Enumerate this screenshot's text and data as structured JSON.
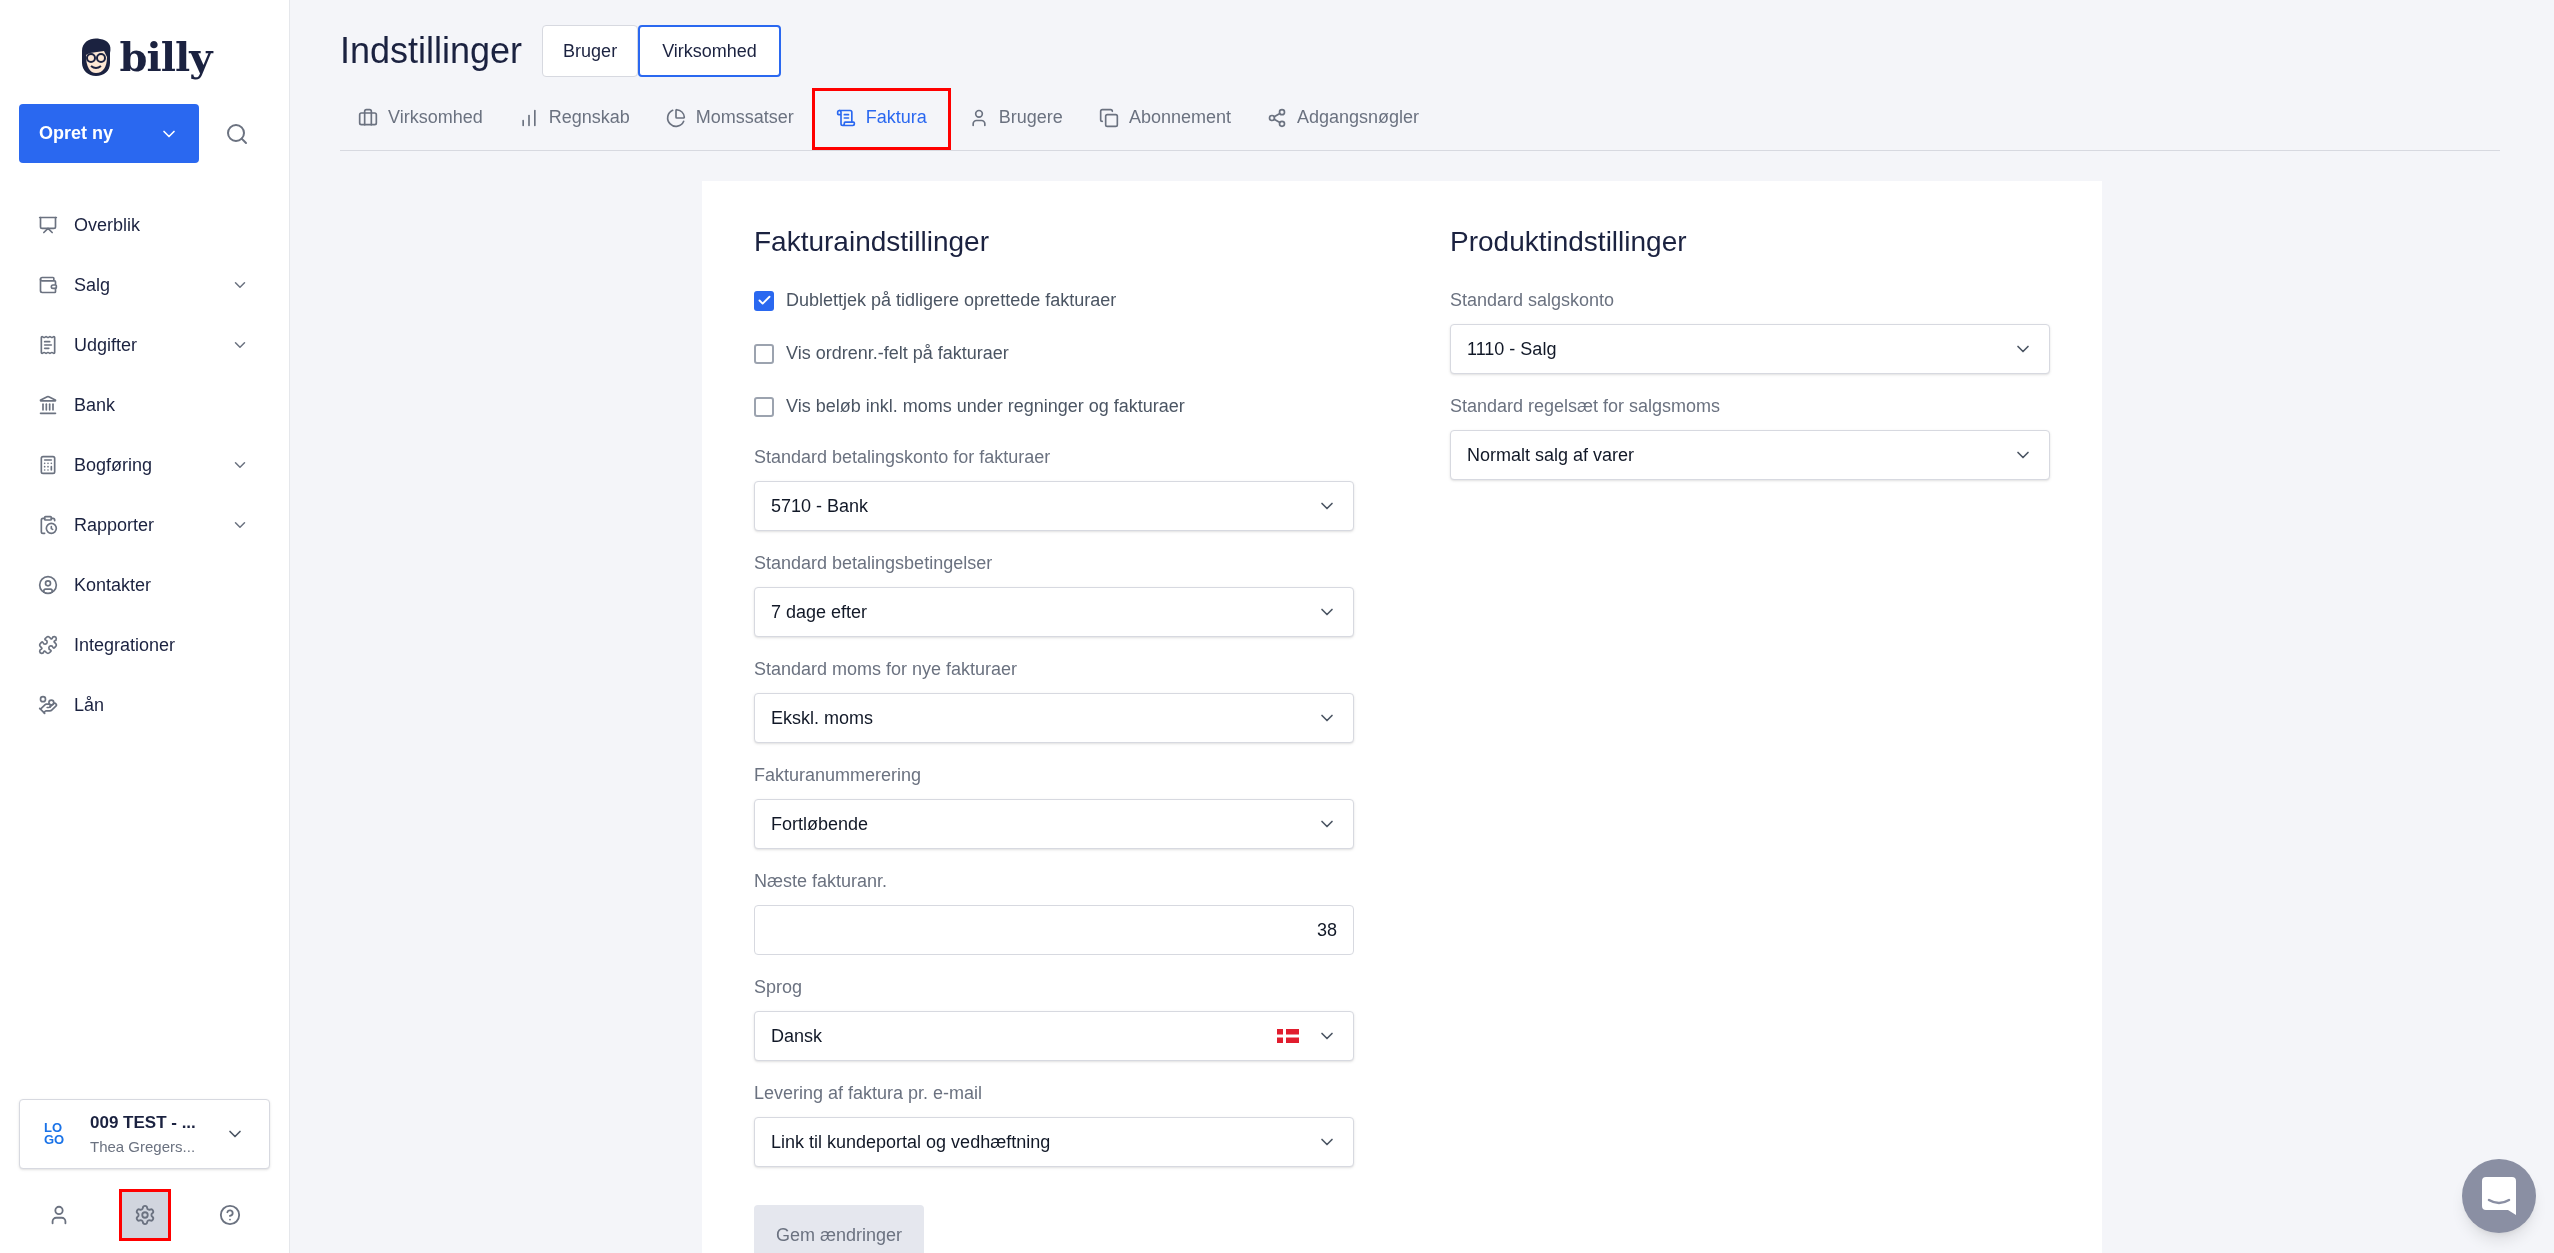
{
  "brand": {
    "name": "billy"
  },
  "sidebar": {
    "create_button": "Opret ny",
    "items": [
      {
        "label": "Overblik",
        "expandable": false
      },
      {
        "label": "Salg",
        "expandable": true
      },
      {
        "label": "Udgifter",
        "expandable": true
      },
      {
        "label": "Bank",
        "expandable": false
      },
      {
        "label": "Bogføring",
        "expandable": true
      },
      {
        "label": "Rapporter",
        "expandable": true
      },
      {
        "label": "Kontakter",
        "expandable": false
      },
      {
        "label": "Integrationer",
        "expandable": false
      },
      {
        "label": "Lån",
        "expandable": false
      }
    ],
    "organization": {
      "logo": "LOGO",
      "name": "009 TEST - ...",
      "user": "Thea Gregers..."
    },
    "footer_icons": [
      {
        "highlighted": false
      },
      {
        "highlighted": true
      },
      {
        "highlighted": false
      }
    ]
  },
  "header": {
    "title": "Indstillinger",
    "scope_toggle": [
      {
        "label": "Bruger",
        "selected": false
      },
      {
        "label": "Virksomhed",
        "selected": true
      }
    ]
  },
  "tabs": [
    {
      "label": "Virksomhed",
      "selected": false,
      "highlighted": false
    },
    {
      "label": "Regnskab",
      "selected": false,
      "highlighted": false
    },
    {
      "label": "Momssatser",
      "selected": false,
      "highlighted": false
    },
    {
      "label": "Faktura",
      "selected": true,
      "highlighted": true
    },
    {
      "label": "Brugere",
      "selected": false,
      "highlighted": false
    },
    {
      "label": "Abonnement",
      "selected": false,
      "highlighted": false
    },
    {
      "label": "Adgangsnøgler",
      "selected": false,
      "highlighted": false
    }
  ],
  "invoice_settings": {
    "title": "Fakturaindstillinger",
    "checkboxes": [
      {
        "label": "Dublettjek på tidligere oprettede fakturaer",
        "checked": true
      },
      {
        "label": "Vis ordrenr.-felt på fakturaer",
        "checked": false
      },
      {
        "label": "Vis beløb inkl. moms under regninger og fakturaer",
        "checked": false
      }
    ],
    "fields": [
      {
        "kind": "select",
        "label": "Standard betalingskonto for fakturaer",
        "value": "5710 - Bank"
      },
      {
        "kind": "select",
        "label": "Standard betalingsbetingelser",
        "value": "7 dage efter"
      },
      {
        "kind": "select",
        "label": "Standard moms for nye fakturaer",
        "value": "Ekskl. moms"
      },
      {
        "kind": "select",
        "label": "Fakturanummerering",
        "value": "Fortløbende"
      },
      {
        "kind": "number",
        "label": "Næste fakturanr.",
        "value": "38"
      },
      {
        "kind": "language",
        "label": "Sprog",
        "value": "Dansk"
      },
      {
        "kind": "select",
        "label": "Levering af faktura pr. e-mail",
        "value": "Link til kundeportal og vedhæftning"
      }
    ],
    "save_button": "Gem ændringer"
  },
  "product_settings": {
    "title": "Produktindstillinger",
    "fields": [
      {
        "kind": "select",
        "label": "Standard salgskonto",
        "value": "1110 - Salg"
      },
      {
        "kind": "select",
        "label": "Standard regelsæt for salgsmoms",
        "value": "Normalt salg af varer"
      }
    ]
  }
}
